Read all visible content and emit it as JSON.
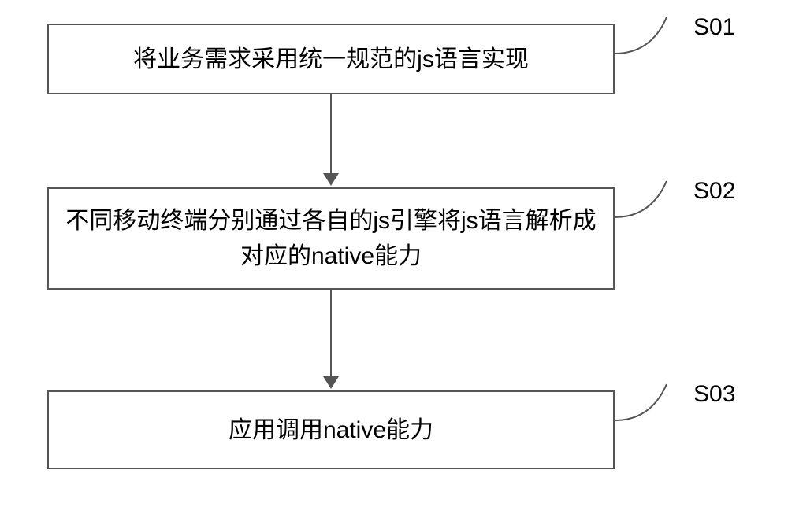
{
  "steps": {
    "s01": {
      "label": "S01",
      "text": "将业务需求采用统一规范的js语言实现"
    },
    "s02": {
      "label": "S02",
      "text": "不同移动终端分别通过各自的js引擎将js语言解析成对应的native能力"
    },
    "s03": {
      "label": "S03",
      "text": "应用调用native能力"
    }
  },
  "chart_data": {
    "type": "flowchart",
    "direction": "top-to-bottom",
    "nodes": [
      {
        "id": "S01",
        "text": "将业务需求采用统一规范的js语言实现"
      },
      {
        "id": "S02",
        "text": "不同移动终端分别通过各自的js引擎将js语言解析成对应的native能力"
      },
      {
        "id": "S03",
        "text": "应用调用native能力"
      }
    ],
    "edges": [
      {
        "from": "S01",
        "to": "S02"
      },
      {
        "from": "S02",
        "to": "S03"
      }
    ]
  }
}
